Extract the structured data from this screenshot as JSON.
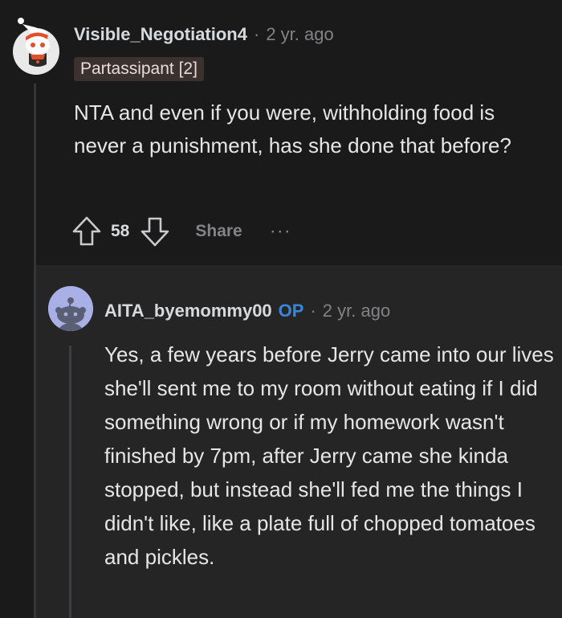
{
  "comment": {
    "username": "Visible_Negotiation4",
    "separator": "·",
    "age": "2 yr. ago",
    "flair": "Partassipant [2]",
    "body": "NTA and even if you were, withholding food is never a punishment, has she done that before?",
    "vote_count": "58",
    "share_label": "Share",
    "more_label": "···"
  },
  "reply": {
    "username": "AITA_byemommy00",
    "op_badge": "OP",
    "separator": "·",
    "age": "2 yr. ago",
    "body": "Yes, a few years before Jerry came into our lives she'll sent me to my room without eating if I did something wrong or if my homework wasn't finished by 7pm, after Jerry came she kinda stopped, but instead she'll fed me the things I didn't like, like a plate full of chopped tomatoes and pickles."
  },
  "colors": {
    "background": "#1a1a1b",
    "reply_background": "#252526",
    "op_badge": "#3a86d8",
    "flair_background": "#3b3230"
  }
}
